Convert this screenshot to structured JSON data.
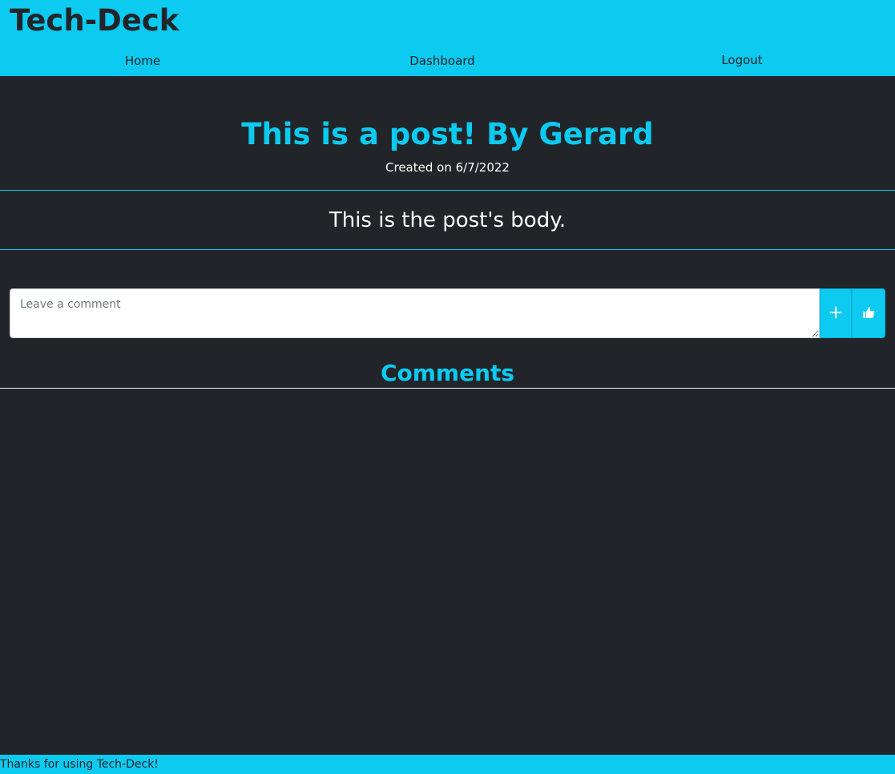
{
  "header": {
    "brand": "Tech-Deck",
    "nav": {
      "home": "Home",
      "dashboard": "Dashboard",
      "logout": "Logout"
    }
  },
  "post": {
    "title": "This is a post! By Gerard",
    "created": "Created on 6/7/2022",
    "body": "This is the post's body."
  },
  "comment_form": {
    "placeholder": "Leave a comment",
    "value": "",
    "add_icon": "plus-icon",
    "like_icon": "thumbs-up-icon"
  },
  "comments": {
    "heading": "Comments",
    "items": []
  },
  "footer": {
    "text": "Thanks for using Tech-Deck!"
  },
  "colors": {
    "accent": "#0dcaf0",
    "background": "#212529",
    "text_light": "#ffffff",
    "text_dark": "#212529"
  }
}
